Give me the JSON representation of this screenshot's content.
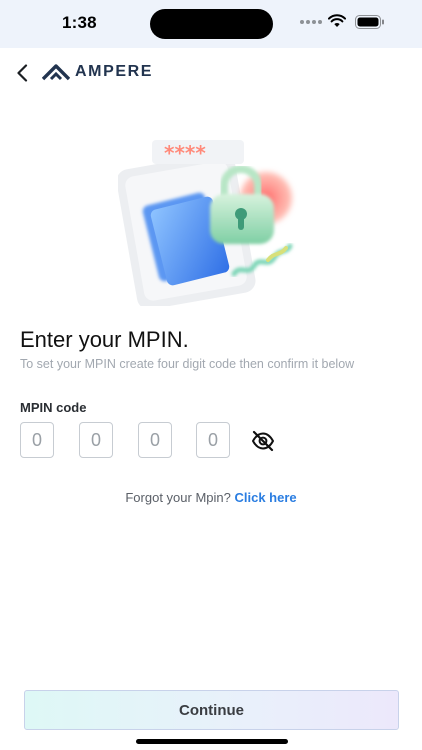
{
  "status_bar": {
    "time": "1:38"
  },
  "header": {
    "brand_name": "AMPERE",
    "brand_color": "#22344f"
  },
  "illustration": {
    "masked_pin": "****",
    "icons": [
      "phone-card-icon",
      "padlock-icon"
    ]
  },
  "main": {
    "title": "Enter your MPIN.",
    "subtitle": "To set your MPIN create four digit code then confirm it below",
    "field_label": "MPIN code",
    "pin_boxes": [
      {
        "value": "",
        "placeholder": "0"
      },
      {
        "value": "",
        "placeholder": "0"
      },
      {
        "value": "",
        "placeholder": "0"
      },
      {
        "value": "",
        "placeholder": "0"
      }
    ],
    "visibility_icon": "eye-off-icon"
  },
  "forgot": {
    "prompt": "Forgot your Mpin?",
    "link_label": "Click here",
    "link_color": "#2a7de1"
  },
  "footer": {
    "continue_label": "Continue"
  }
}
